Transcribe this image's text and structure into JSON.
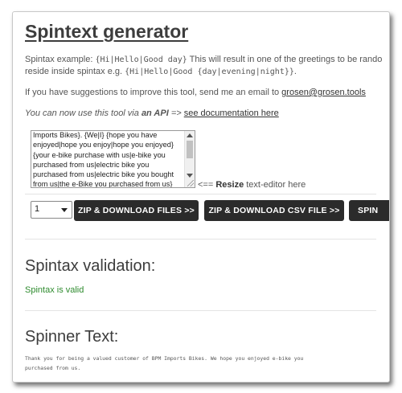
{
  "header": {
    "title": "Spintext generator"
  },
  "intro": {
    "example_prefix": "Spintax example: ",
    "example_code": "{Hi|Hello|Good day}",
    "example_suffix": " This will result in one of the greetings to be rando",
    "nested_prefix": "reside inside spintax e.g. ",
    "nested_code": "{Hi|Hello|Good {day|evening|night}}",
    "nested_suffix": ".",
    "suggest_text": "If you have suggestions to improve this tool, send me an email to ",
    "email": "grosen@grosen.tools",
    "api_prefix": "You can now use this tool via ",
    "api_bold": "an API",
    "api_arrow": " => ",
    "api_link": "see documentation here"
  },
  "editor": {
    "value": "Imports Bikes}. {We|I} {hope you have enjoyed|hope you enjoy|hope you enjoyed} {your e-bike purchase with us|e-bike you purchased from us|electric bike you purchased from us|electric bike you bought from us|the e-Bike you purchased from us}",
    "resize_prefix": "<== ",
    "resize_bold": "Resize",
    "resize_suffix": " text-editor here"
  },
  "controls": {
    "count_value": "1",
    "zip_files_label": "ZIP & DOWNLOAD FILES >>",
    "zip_csv_label": "ZIP & DOWNLOAD CSV FILE >>",
    "spin_label": "SPIN"
  },
  "validation": {
    "heading": "Spintax validation:",
    "status": "Spintax is valid",
    "status_color": "#2e8b2e"
  },
  "spinner": {
    "heading": "Spinner Text:",
    "output": "Thank you for being a valued customer of BPM Imports Bikes. We hope you enjoyed e-bike you purchased from us."
  }
}
